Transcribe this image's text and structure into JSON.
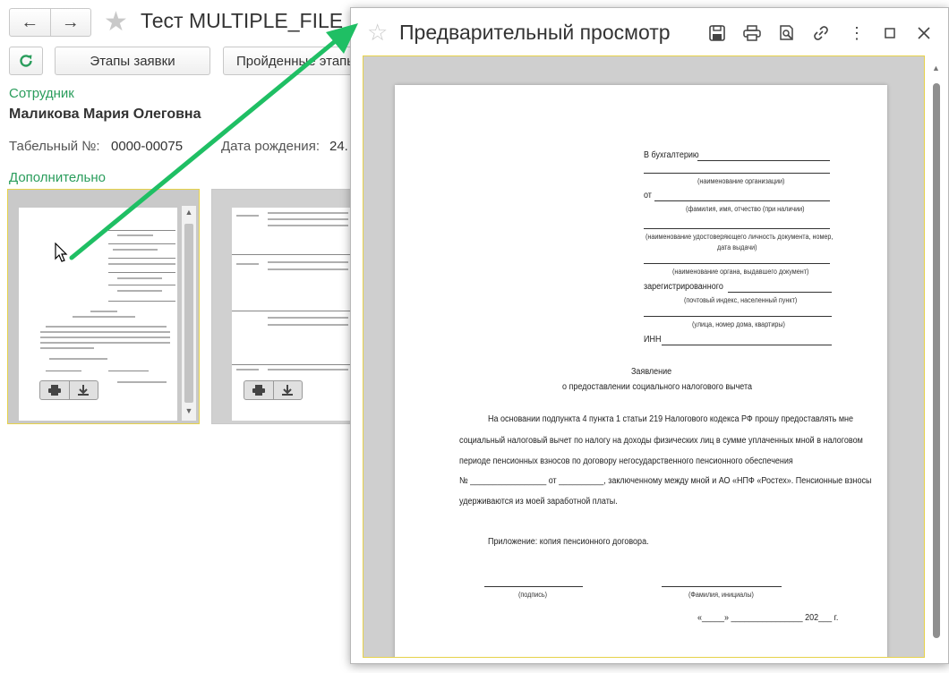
{
  "form": {
    "title": "Тест MULTIPLE_FILE",
    "buttons": {
      "stages": "Этапы заявки",
      "passed": "Пройденные этапы"
    },
    "employee_label": "Сотрудник",
    "employee_name": "Маликова Мария Олеговна",
    "tabnum_label": "Табельный №:",
    "tabnum_value": "0000-00075",
    "birth_label": "Дата рождения:",
    "birth_value": "24.",
    "additional_label": "Дополнительно"
  },
  "window": {
    "title": "Предварительный просмотр"
  },
  "doc": {
    "to_accounting": "В бухгалтерию",
    "org_hint": "(наименование организации)",
    "from": "от",
    "fio_hint": "(фамилия, имя, отчество (при наличии)",
    "id_hint_1": "(наименование удостоверяющего личность документа, номер,",
    "id_hint_2": "дата выдачи)",
    "issuer_hint": "(наименование органа, выдавшего документ)",
    "registered": "зарегистрированного",
    "postal_hint": "(почтовый индекс, населенный пункт)",
    "street_hint": "(улица, номер дома, квартиры)",
    "inn": "ИНН",
    "heading_1": "Заявление",
    "heading_2": "о предоставлении социального налогового вычета",
    "body_1": "На основании подпункта 4 пункта 1 статьи 219 Налогового кодекса РФ прошу предоставлять мне",
    "body_2": "социальный налоговый вычет по налогу на доходы физических лиц в сумме уплаченных мной в налоговом",
    "body_3": "периоде   пенсионных   взносов   по   договору   негосударственного   пенсионного   обеспечения",
    "body_4": "№ _________________ от __________, заключенному между мной и АО «НПФ «Ростех». Пенсионные взносы",
    "body_5": "удерживаются из моей заработной платы.",
    "attachment": "Приложение: копия пенсионного договора.",
    "sign_hint": "(подпись)",
    "name_hint": "(Фамилия, инициалы)",
    "date_line": "«_____» ________________ 202___ г."
  }
}
